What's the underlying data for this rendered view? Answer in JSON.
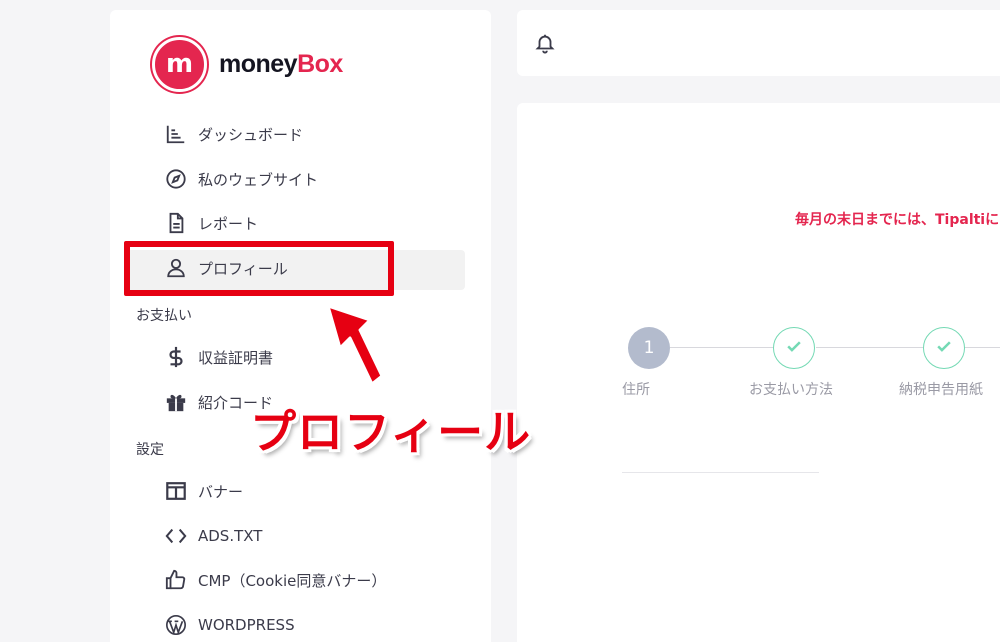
{
  "brand": {
    "money": "money",
    "box": "Box",
    "mark": "m"
  },
  "nav": {
    "dashboard": "ダッシュボード",
    "websites": "私のウェブサイト",
    "reports": "レポート",
    "profile": "プロフィール",
    "payments_section": "お支払い",
    "income": "収益証明書",
    "referral": "紹介コード",
    "settings_section": "設定",
    "banner": "バナー",
    "adstxt": "ADS.TXT",
    "cmp": "CMP（Cookie同意バナー）",
    "wordpress": "WORDPRESS"
  },
  "annotation": {
    "callout": "プロフィール"
  },
  "content": {
    "notice": "毎月の末日までには、Tipaltiに",
    "steps": [
      {
        "num": "1",
        "label": "住所"
      },
      {
        "label": "お支払い方法"
      },
      {
        "label": "納税申告用紙"
      }
    ]
  },
  "colors": {
    "brand": "#e4264f",
    "annotation": "#e60012",
    "check": "#74d9b4",
    "step_active": "#b3bbcd"
  }
}
